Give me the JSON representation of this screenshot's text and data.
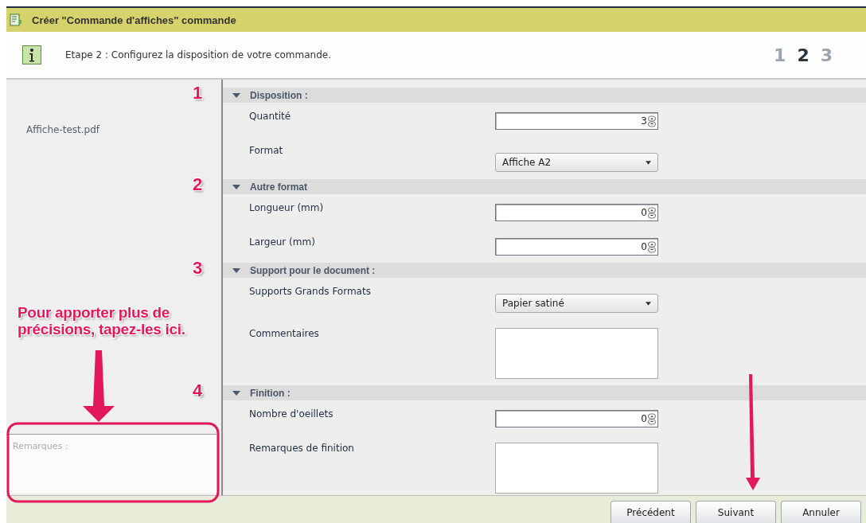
{
  "window": {
    "title": "Créer \"Commande d'affiches\" commande"
  },
  "info": {
    "text": "Etape 2 : Configurez la disposition de votre commande."
  },
  "steps": [
    {
      "label": "1",
      "selected": false
    },
    {
      "label": "2",
      "selected": true
    },
    {
      "label": "3",
      "selected": false
    }
  ],
  "sidebar": {
    "file": "Affiche-test.pdf",
    "remarks": {
      "placeholder": "Remarques :"
    }
  },
  "sections": [
    {
      "title": "Disposition :",
      "marker": "1",
      "expanded": true,
      "rows": [
        {
          "label": "Quantité",
          "kind": "spin",
          "value": "3"
        },
        {
          "label": "Format",
          "kind": "select",
          "value": "Affiche A2"
        }
      ]
    },
    {
      "title": "Autre format",
      "marker": "2",
      "expanded": true,
      "rows": [
        {
          "label": "Longueur (mm)",
          "kind": "spin",
          "value": "0"
        },
        {
          "label": "Largeur (mm)",
          "kind": "spin",
          "value": "0"
        }
      ]
    },
    {
      "title": "Support pour le document :",
      "marker": "3",
      "expanded": true,
      "rows": [
        {
          "label": "Supports Grands Formats",
          "kind": "select",
          "value": "Papier satiné"
        },
        {
          "label": "Commentaires",
          "kind": "textarea"
        }
      ]
    },
    {
      "title": "Finition :",
      "marker": "4",
      "expanded": true,
      "rows": [
        {
          "label": "Nombre d'oeillets",
          "kind": "spin",
          "value": "0"
        },
        {
          "label": "Remarques de finition",
          "kind": "textarea"
        }
      ]
    }
  ],
  "callout": "Pour apporter plus de précisions, tapez-les ici.",
  "buttons": [
    "Précédent",
    "Suivant",
    "Annuler"
  ]
}
